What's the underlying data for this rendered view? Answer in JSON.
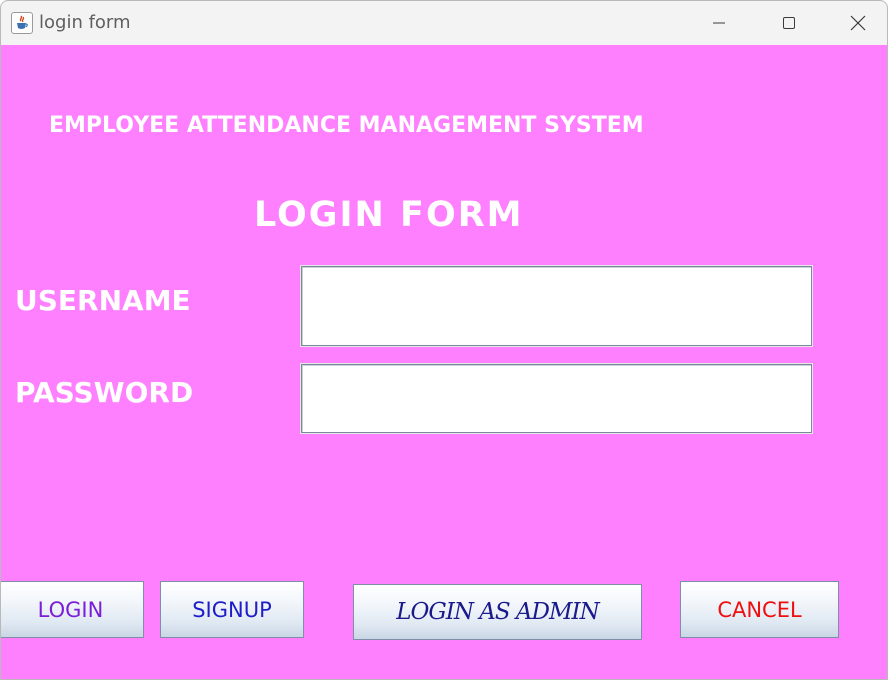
{
  "window": {
    "title": "login form",
    "icon": "java-cup-icon",
    "controls": [
      "minimize-icon",
      "maximize-icon",
      "close-icon"
    ]
  },
  "form": {
    "system_title": "EMPLOYEE ATTENDANCE MANAGEMENT SYSTEM",
    "form_title": "LOGIN FORM",
    "username_label": "USERNAME",
    "username_value": "",
    "password_label": "PASSWORD",
    "password_value": ""
  },
  "buttons": {
    "login": "LOGIN",
    "signup": "SIGNUP",
    "login_admin": "LOGIN AS ADMIN",
    "cancel": "CANCEL"
  },
  "colors": {
    "background": "#ff80ff",
    "heading_text": "#ffffff",
    "login_text": "#7a1fd6",
    "signup_text": "#1e1ec8",
    "admin_text": "#1a1a8a",
    "cancel_text": "#ee1010"
  }
}
